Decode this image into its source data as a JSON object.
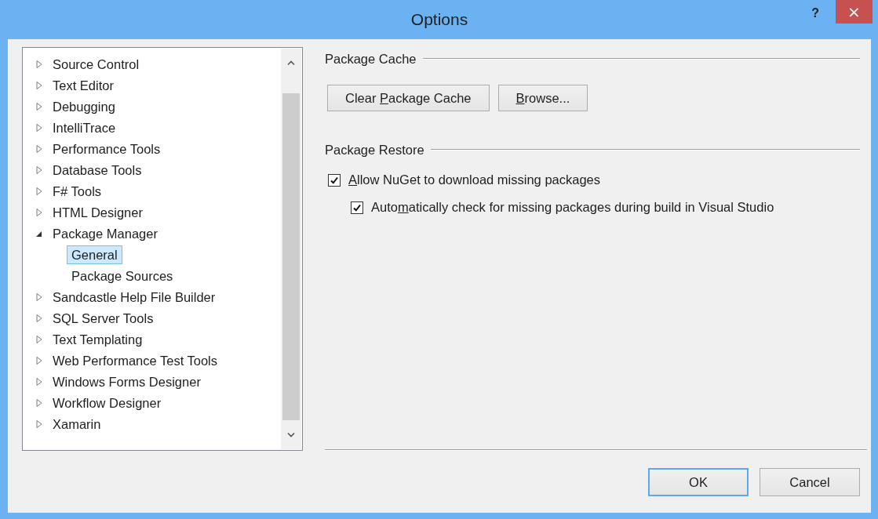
{
  "window": {
    "title": "Options",
    "help_button": "?",
    "close_button": "×"
  },
  "tree": [
    {
      "label": "Source Control",
      "expanded": false,
      "selected": false
    },
    {
      "label": "Text Editor",
      "expanded": false,
      "selected": false
    },
    {
      "label": "Debugging",
      "expanded": false,
      "selected": false
    },
    {
      "label": "IntelliTrace",
      "expanded": false,
      "selected": false
    },
    {
      "label": "Performance Tools",
      "expanded": false,
      "selected": false
    },
    {
      "label": "Database Tools",
      "expanded": false,
      "selected": false
    },
    {
      "label": "F# Tools",
      "expanded": false,
      "selected": false
    },
    {
      "label": "HTML Designer",
      "expanded": false,
      "selected": false
    },
    {
      "label": "Package Manager",
      "expanded": true,
      "selected": false,
      "children": [
        {
          "label": "General",
          "selected": true
        },
        {
          "label": "Package Sources",
          "selected": false
        }
      ]
    },
    {
      "label": "Sandcastle Help File Builder",
      "expanded": false,
      "selected": false
    },
    {
      "label": "SQL Server Tools",
      "expanded": false,
      "selected": false
    },
    {
      "label": "Text Templating",
      "expanded": false,
      "selected": false
    },
    {
      "label": "Web Performance Test Tools",
      "expanded": false,
      "selected": false
    },
    {
      "label": "Windows Forms Designer",
      "expanded": false,
      "selected": false
    },
    {
      "label": "Workflow Designer",
      "expanded": false,
      "selected": false
    },
    {
      "label": "Xamarin",
      "expanded": false,
      "selected": false
    }
  ],
  "sections": [
    {
      "title": "Package Cache",
      "buttons": [
        {
          "parts": [
            {
              "text": "Clear ",
              "access_key": false
            },
            {
              "text": "P",
              "access_key": true
            },
            {
              "text": "ackage Cache",
              "access_key": false
            }
          ]
        },
        {
          "parts": [
            {
              "text": "B",
              "access_key": true
            },
            {
              "text": "rowse...",
              "access_key": false
            }
          ]
        }
      ]
    },
    {
      "title": "Package Restore",
      "checkboxes": [
        {
          "checked": true,
          "parts": [
            {
              "text": "A",
              "access_key": true
            },
            {
              "text": "llow NuGet to download missing packages",
              "access_key": false
            }
          ],
          "children": [
            {
              "checked": true,
              "parts": [
                {
                  "text": "Auto",
                  "access_key": false
                },
                {
                  "text": "m",
                  "access_key": true
                },
                {
                  "text": "atically check for missing packages during build in Visual Studio",
                  "access_key": false
                }
              ]
            }
          ]
        }
      ]
    }
  ],
  "dialog_buttons": [
    {
      "label": "OK",
      "default": true
    },
    {
      "label": "Cancel",
      "default": false
    }
  ]
}
